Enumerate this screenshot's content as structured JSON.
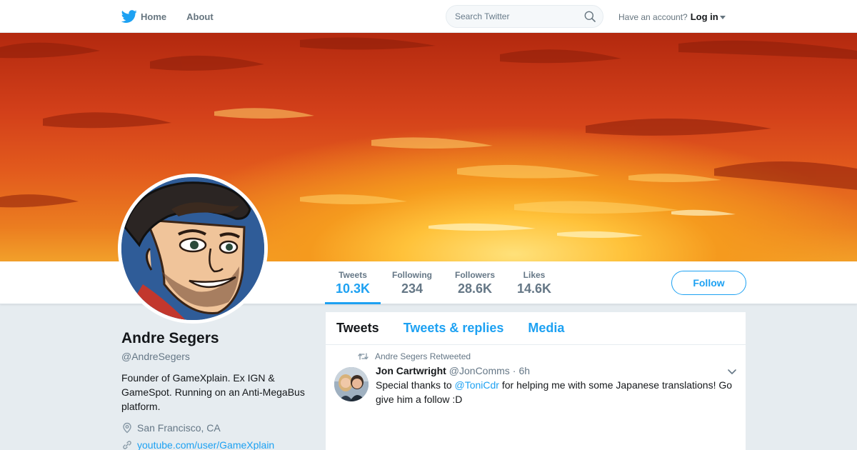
{
  "nav": {
    "home_label": "Home",
    "about_label": "About",
    "search_placeholder": "Search Twitter",
    "account_prompt": "Have an account?",
    "login_label": "Log in"
  },
  "profile_nav": {
    "stats": [
      {
        "label": "Tweets",
        "value": "10.3K"
      },
      {
        "label": "Following",
        "value": "234"
      },
      {
        "label": "Followers",
        "value": "28.6K"
      },
      {
        "label": "Likes",
        "value": "14.6K"
      }
    ],
    "follow_label": "Follow"
  },
  "profile": {
    "name": "Andre Segers",
    "handle": "@AndreSegers",
    "bio": "Founder of GameXplain. Ex IGN & GameSpot. Running on an Anti-MegaBus platform.",
    "location": "San Francisco, CA",
    "website": "youtube.com/user/GameXplain"
  },
  "timeline": {
    "tabs": [
      "Tweets",
      "Tweets & replies",
      "Media"
    ],
    "tweet": {
      "retweet_notice": "Andre Segers Retweeted",
      "author": "Jon Cartwright",
      "handle": "@JonComms",
      "separator": "·",
      "time": "6h",
      "text_before": "Special thanks to ",
      "mention": "@ToniCdr",
      "text_after": " for helping me with some Japanese translations! Go give him a follow :D"
    }
  },
  "colors": {
    "brand": "#1da1f2",
    "page_bg": "#e6ecf0",
    "text": "#14171a",
    "muted": "#657786"
  },
  "icons": [
    "twitter-bird-icon",
    "search-icon",
    "caret-down-icon",
    "location-pin-icon",
    "link-icon",
    "retweet-icon",
    "chevron-down-icon"
  ]
}
